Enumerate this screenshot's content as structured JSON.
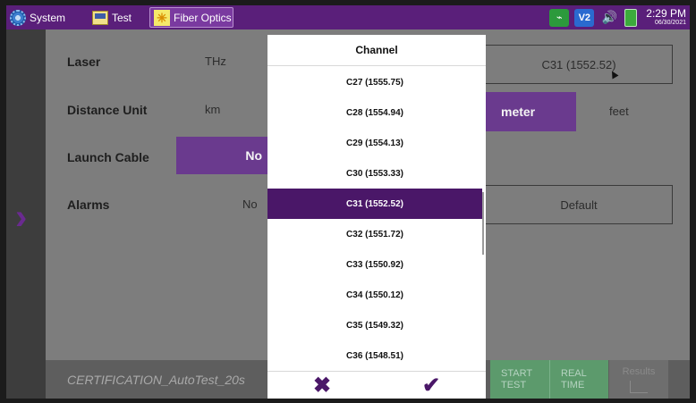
{
  "topbar": {
    "tabs": [
      {
        "label": "System",
        "icon": "gear-icon"
      },
      {
        "label": "Test",
        "icon": "bert-icon"
      },
      {
        "label": "Fiber Optics",
        "icon": "fiber-optics-icon"
      }
    ],
    "status": {
      "v2_label": "V2",
      "time": "2:29 PM",
      "date": "06/30/2021"
    }
  },
  "settings": {
    "laser_label": "Laser",
    "laser_unit": "THz",
    "laser_channel_value": "C31 (1552.52)",
    "distance_label": "Distance Unit",
    "distance_km": "km",
    "distance_meter": "meter",
    "distance_feet": "feet",
    "launch_label": "Launch Cable",
    "launch_value": "No",
    "alarms_label": "Alarms",
    "alarms_value": "No",
    "alarms_threshold": "Default"
  },
  "bottombar": {
    "test_name": "CERTIFICATION_AutoTest_20s",
    "start_test": [
      "START",
      "TEST"
    ],
    "real_time": [
      "REAL",
      "TIME"
    ],
    "results": "Results"
  },
  "popup": {
    "title": "Channel",
    "options": [
      "C27 (1555.75)",
      "C28 (1554.94)",
      "C29 (1554.13)",
      "C30 (1553.33)",
      "C31 (1552.52)",
      "C32 (1551.72)",
      "C33 (1550.92)",
      "C34 (1550.12)",
      "C35 (1549.32)",
      "C36 (1548.51)"
    ],
    "selected_index": 4,
    "cancel_symbol": "✖",
    "confirm_symbol": "✔"
  },
  "colors": {
    "accent": "#5a1f7a",
    "selected": "#4a1768",
    "start_button": "#5c9a6c"
  }
}
